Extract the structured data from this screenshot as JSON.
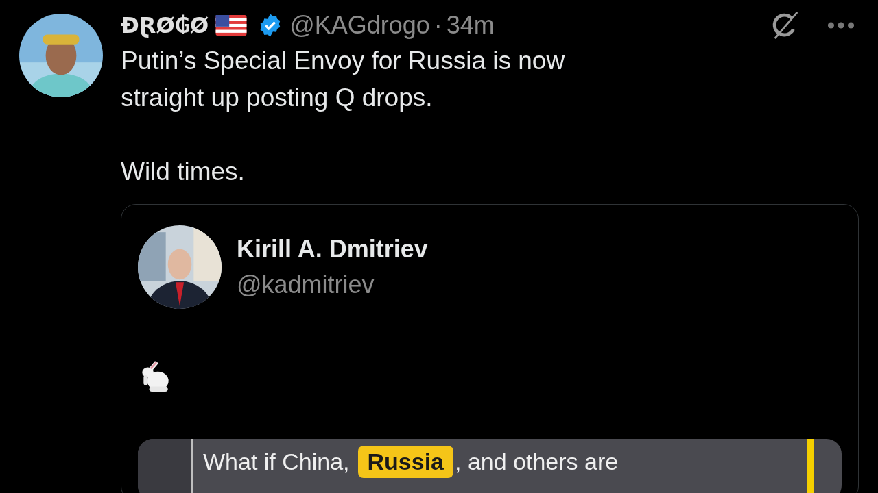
{
  "post": {
    "display_name": "ĐⱤØ₲Ø",
    "verified": true,
    "handle": "@KAGdrogo",
    "separator": "·",
    "time": "34m",
    "paragraphs": [
      [
        "Putin’s Special Envoy for Russia is now",
        "straight up posting Q drops."
      ],
      [
        "Wild times."
      ]
    ],
    "quote": {
      "display_name": "Kirill A. Dmitriev",
      "handle": "@kadmitriev",
      "media": {
        "parts": [
          {
            "text": "What if China,",
            "highlighted": false
          },
          {
            "text": "Russia",
            "highlighted": true
          },
          {
            "text": ", and others are",
            "highlighted": false
          }
        ]
      }
    }
  }
}
